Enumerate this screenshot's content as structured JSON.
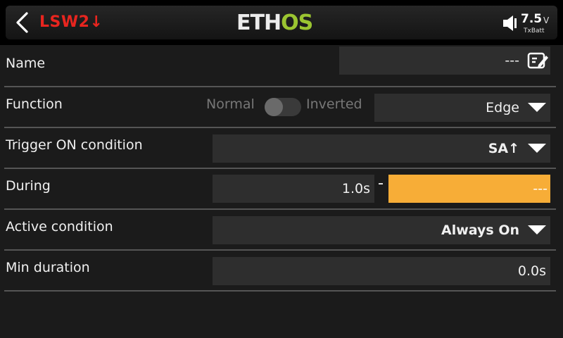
{
  "header": {
    "title": "LSW2↓",
    "logo_left": "ETH",
    "logo_right": "OS",
    "battery_value": "7.5",
    "battery_unit": "V",
    "battery_name": "TxBatt"
  },
  "rows": {
    "name": {
      "label": "Name",
      "value": "---"
    },
    "function": {
      "label": "Function",
      "toggle_off": "Normal",
      "toggle_on": "Inverted",
      "value": "Edge",
      "inverted": false
    },
    "trigger": {
      "label": "Trigger ON condition",
      "value": "SA↑"
    },
    "during": {
      "label": "During",
      "start": "1.0s",
      "end": "---"
    },
    "active": {
      "label": "Active condition",
      "value": "Always On"
    },
    "min_duration": {
      "label": "Min duration",
      "value": "0.0s"
    }
  },
  "colors": {
    "title": "#e8251f",
    "accent": "#9bc531",
    "highlight": "#f7ad37"
  }
}
